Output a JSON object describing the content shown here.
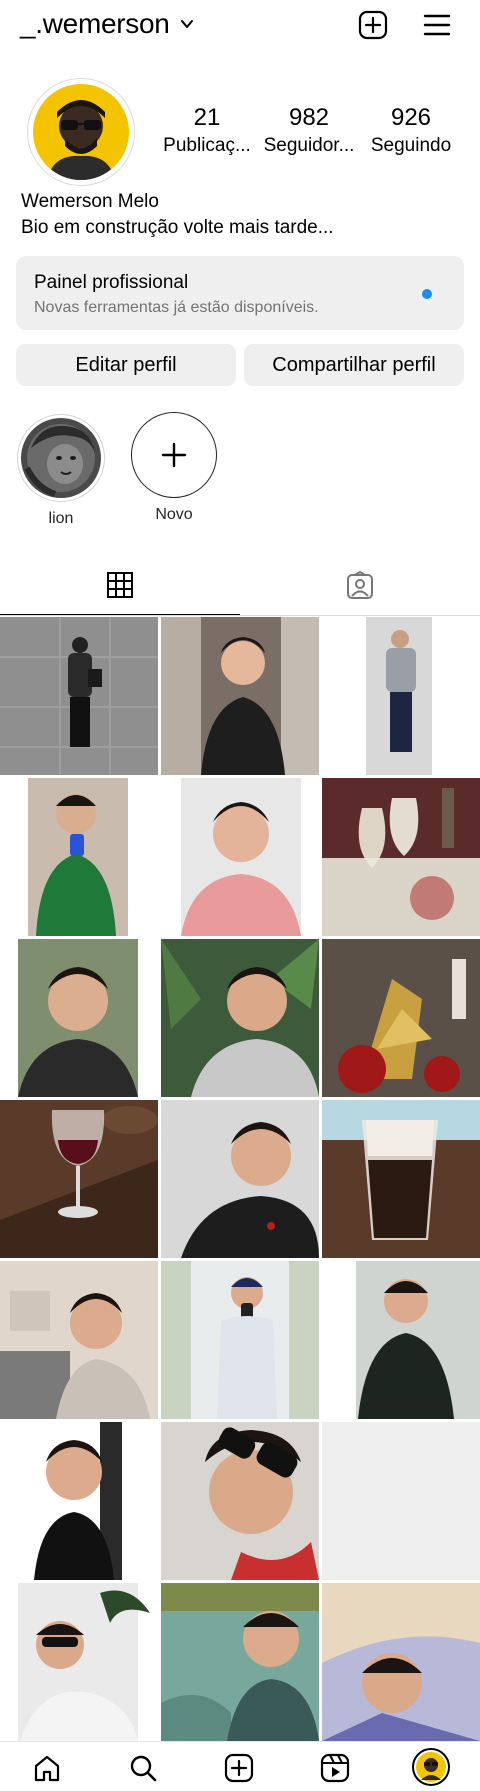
{
  "header": {
    "username": "_.wemerson",
    "icons": {
      "create": "plus-square-icon",
      "menu": "hamburger-menu-icon",
      "chevron": "chevron-down-icon"
    }
  },
  "profile": {
    "stats": [
      {
        "value": "21",
        "label": "Publicaç..."
      },
      {
        "value": "982",
        "label": "Seguidor..."
      },
      {
        "value": "926",
        "label": "Seguindo"
      }
    ],
    "name": "Wemerson Melo",
    "bio": "Bio em construção volte mais tarde..."
  },
  "panel": {
    "title": "Painel profissional",
    "subtitle": "Novas ferramentas já estão disponíveis.",
    "dot_color": "#1d8cf0"
  },
  "buttons": {
    "edit": "Editar perfil",
    "share": "Compartilhar perfil"
  },
  "highlights": [
    {
      "label": "lion"
    },
    {
      "label": "Novo"
    }
  ],
  "tabs": {
    "grid": "grid-icon",
    "tagged": "tagged-person-icon"
  },
  "posts_count_visible": 21,
  "nav": [
    "home-icon",
    "search-icon",
    "create-icon",
    "reels-icon",
    "profile-avatar"
  ]
}
